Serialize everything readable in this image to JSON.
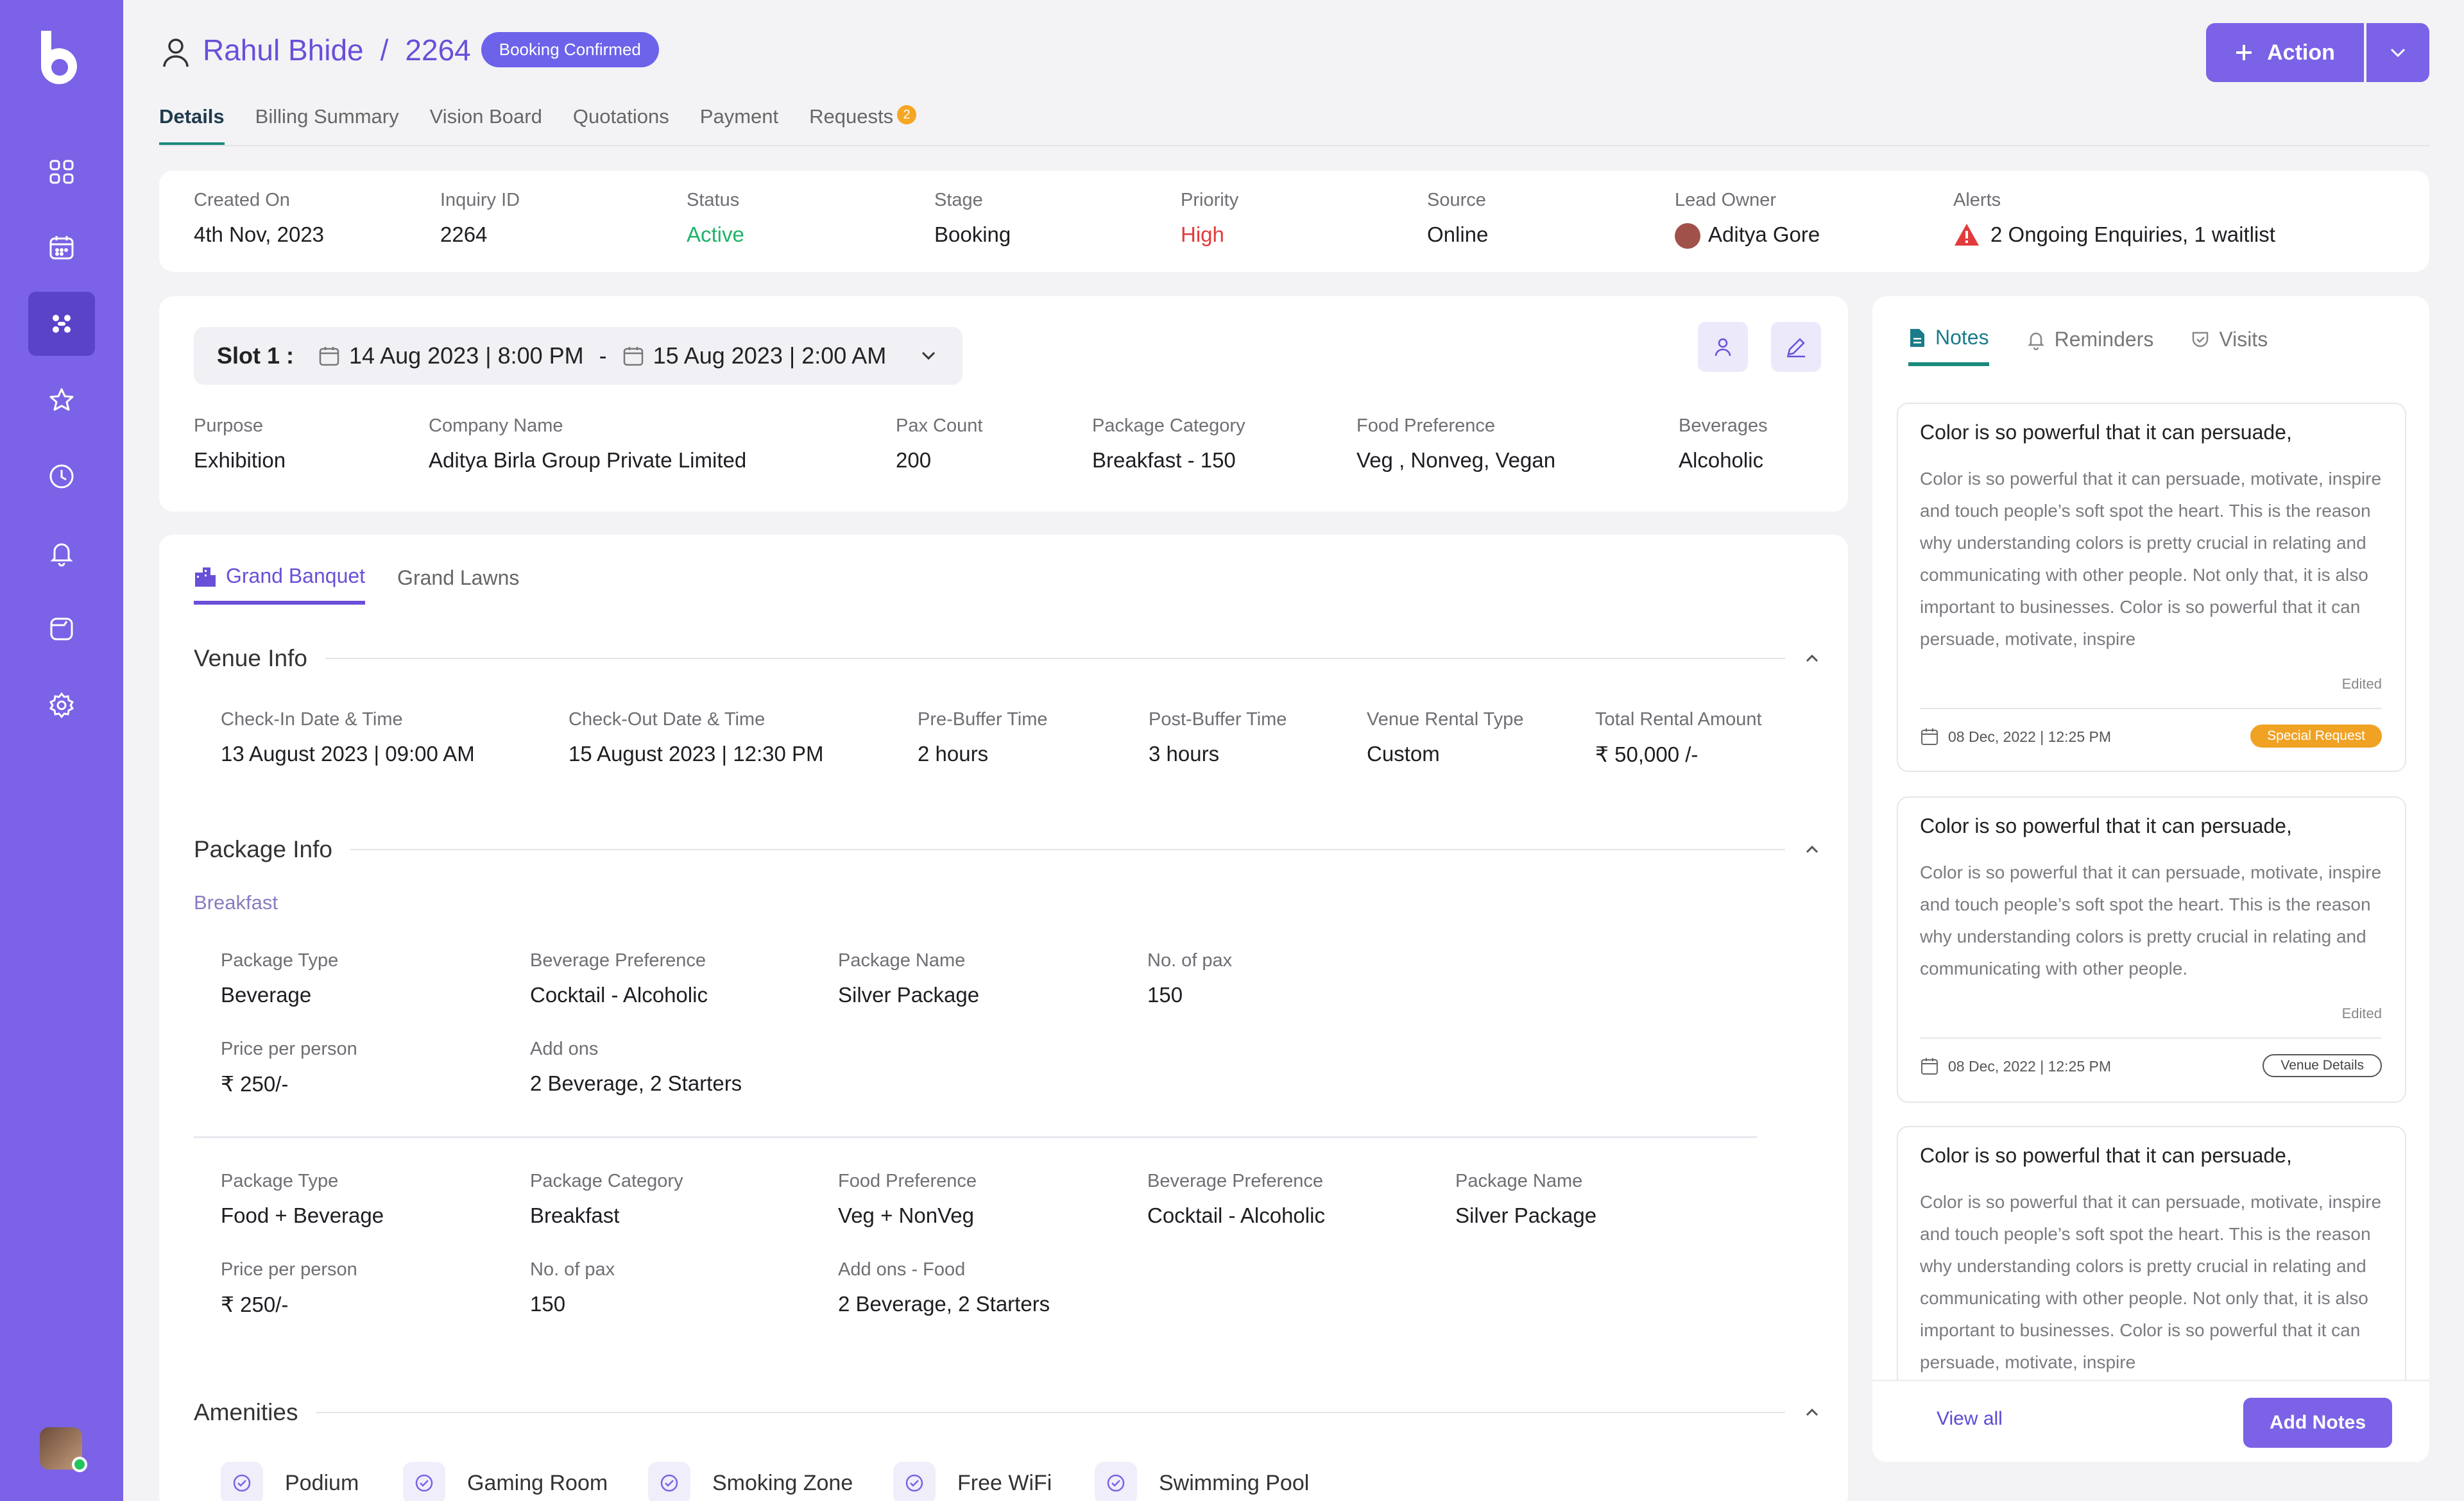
{
  "header": {
    "customer_name": "Rahul Bhide",
    "separator": "/",
    "inquiry_number": "2264",
    "status_badge": "Booking Confirmed",
    "action_label": "Action"
  },
  "tabs": [
    {
      "label": "Details"
    },
    {
      "label": "Billing Summary"
    },
    {
      "label": "Vision Board"
    },
    {
      "label": "Quotations"
    },
    {
      "label": "Payment"
    },
    {
      "label": "Requests",
      "count": "2"
    }
  ],
  "summary": {
    "created_on": {
      "label": "Created On",
      "value": "4th Nov, 2023"
    },
    "inquiry_id": {
      "label": "Inquiry ID",
      "value": "2264"
    },
    "status": {
      "label": "Status",
      "value": "Active"
    },
    "stage": {
      "label": "Stage",
      "value": "Booking"
    },
    "priority": {
      "label": "Priority",
      "value": "High"
    },
    "source": {
      "label": "Source",
      "value": "Online"
    },
    "lead_owner": {
      "label": "Lead Owner",
      "value": "Aditya Gore"
    },
    "alerts": {
      "label": "Alerts",
      "value": "2 Ongoing Enquiries, 1 waitlist"
    }
  },
  "slot": {
    "label": "Slot 1 :",
    "start": "14 Aug 2023 | 8:00 PM",
    "dash": "-",
    "end": "15 Aug 2023 | 2:00 AM",
    "purpose": {
      "label": "Purpose",
      "value": "Exhibition"
    },
    "company": {
      "label": "Company Name",
      "value": "Aditya Birla Group Private Limited"
    },
    "pax": {
      "label": "Pax Count",
      "value": "200"
    },
    "package_category": {
      "label": "Package Category",
      "value": "Breakfast - 150"
    },
    "food_pref": {
      "label": "Food Preference",
      "value": "Veg , Nonveg, Vegan"
    },
    "beverages": {
      "label": "Beverages",
      "value": "Alcoholic"
    }
  },
  "venue_tabs": [
    {
      "label": "Grand Banquet"
    },
    {
      "label": "Grand Lawns"
    }
  ],
  "venue_info": {
    "title": "Venue Info",
    "checkin": {
      "label": "Check-In Date & Time",
      "value": "13 August 2023  |  09:00 AM"
    },
    "checkout": {
      "label": "Check-Out Date & Time",
      "value": "15 August 2023  |  12:30 PM"
    },
    "pre_buffer": {
      "label": "Pre-Buffer Time",
      "value": "2 hours"
    },
    "post_buffer": {
      "label": "Post-Buffer Time",
      "value": "3 hours"
    },
    "rental_type": {
      "label": "Venue Rental Type",
      "value": "Custom"
    },
    "rental_amount": {
      "label": "Total Rental Amount",
      "value": "₹ 50,000 /-"
    }
  },
  "package_info": {
    "title": "Package Info",
    "subtitle": "Breakfast",
    "p1": {
      "type": {
        "label": "Package Type",
        "value": "Beverage"
      },
      "bev_pref": {
        "label": "Beverage Preference",
        "value": "Cocktail - Alcoholic"
      },
      "name": {
        "label": "Package Name",
        "value": "Silver Package"
      },
      "pax": {
        "label": "No. of pax",
        "value": "150"
      },
      "price": {
        "label": "Price per person",
        "value": "₹ 250/-"
      },
      "addons": {
        "label": "Add ons",
        "value": "2 Beverage, 2 Starters"
      }
    },
    "p2": {
      "type": {
        "label": "Package Type",
        "value": "Food + Beverage"
      },
      "category": {
        "label": "Package Category",
        "value": "Breakfast"
      },
      "food_pref": {
        "label": "Food Preference",
        "value": "Veg + NonVeg"
      },
      "bev_pref": {
        "label": "Beverage Preference",
        "value": "Cocktail - Alcoholic"
      },
      "name": {
        "label": "Package Name",
        "value": "Silver Package"
      },
      "price": {
        "label": "Price per person",
        "value": "₹ 250/-"
      },
      "pax": {
        "label": "No. of pax",
        "value": "150"
      },
      "addons": {
        "label": "Add ons - Food",
        "value": "2 Beverage, 2 Starters"
      }
    }
  },
  "amenities": {
    "title": "Amenities",
    "items": [
      "Podium",
      "Gaming Room",
      "Smoking Zone",
      "Free WiFi",
      "Swimming Pool"
    ]
  },
  "notes_panel": {
    "tabs": [
      {
        "label": "Notes"
      },
      {
        "label": "Reminders"
      },
      {
        "label": "Visits"
      }
    ],
    "notes": [
      {
        "title": "Color is so powerful that it can persuade,",
        "body": "Color is so powerful that it can persuade, motivate, inspire and touch people’s soft spot the heart. This is the reason why understanding colors is pretty crucial in relating and communicating with other people. Not only that, it is also important to businesses. Color is so powerful that it can persuade, motivate, inspire",
        "edited": "Edited",
        "date": "08 Dec, 2022 | 12:25 PM",
        "tag": "Special Request"
      },
      {
        "title": "Color is so powerful that it can persuade,",
        "body": "Color is so powerful that it can persuade, motivate, inspire and touch people’s soft spot the heart. This is the reason why understanding colors is pretty crucial in relating and communicating with other people.",
        "edited": "Edited",
        "date": "08 Dec, 2022 | 12:25 PM",
        "tag": "Venue Details"
      },
      {
        "title": "Color is so powerful that it can persuade,",
        "body": "Color is so powerful that it can persuade, motivate, inspire and touch people’s soft spot the heart. This is the reason why understanding colors is pretty crucial in relating and communicating with other people. Not only that, it is also important to businesses. Color is so powerful that it can persuade, motivate, inspire"
      }
    ],
    "view_all": "View all",
    "add_notes": "Add Notes"
  },
  "colors": {
    "brand": "#7b62e6",
    "accent_teal": "#1a8a7c",
    "status_active": "#20b26b",
    "priority_high": "#e23b3b",
    "tag_orange": "#f0a224"
  },
  "icons": {
    "sidebar": [
      "dashboard-icon",
      "calendar-icon",
      "inquiries-icon",
      "star-icon",
      "clock-icon",
      "bell-icon",
      "folder-icon",
      "settings-icon"
    ]
  }
}
